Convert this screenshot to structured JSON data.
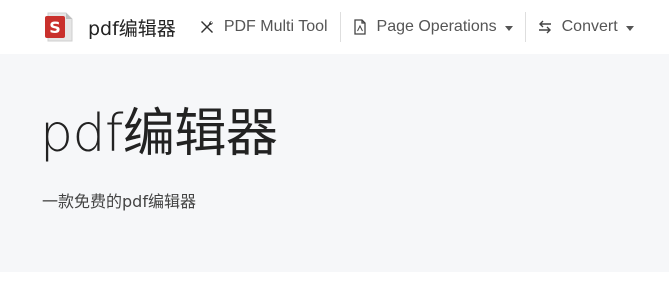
{
  "navbar": {
    "brand": {
      "logo_icon": "s-red-document-icon",
      "logo_letter": "S",
      "title": "pdf编辑器"
    },
    "items": [
      {
        "label": "PDF Multi Tool",
        "icon": "wrench-screwdriver-icon",
        "dropdown": false
      },
      {
        "label": "Page Operations",
        "icon": "file-icon",
        "dropdown": true
      },
      {
        "label": "Convert",
        "icon": "arrows-exchange-icon",
        "dropdown": true
      }
    ]
  },
  "hero": {
    "title": "pdf编辑器",
    "subtitle": "一款免费的pdf编辑器"
  },
  "colors": {
    "brand_red": "#c9302c",
    "nav_text": "#555555",
    "hero_bg": "#f6f7f9"
  }
}
